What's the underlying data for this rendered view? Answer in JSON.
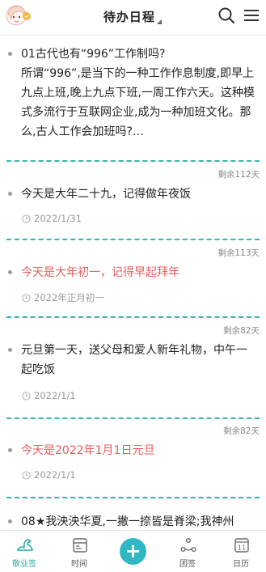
{
  "header": {
    "title": "待办日程",
    "caret": "◢"
  },
  "items": [
    {
      "text": "01古代也有“996”工作制吗?\n所谓“996”,是当下的一种工作作息制度,即早上九点上班,晚上九点下班,一周工作六天。这种模式多流行于互联网企业,成为一种加班文化。那么,古人工作会加班吗?…",
      "date": "",
      "highlight": false,
      "remaining": "剩余112天"
    },
    {
      "text": "今天是大年二十九，记得做年夜饭",
      "date": "2022/1/31",
      "highlight": false,
      "remaining": "剩余113天"
    },
    {
      "text": "今天是大年初一，记得早起拜年",
      "date": "2022年正月初一",
      "highlight": true,
      "remaining": "剩余82天"
    },
    {
      "text": "元旦第一天，送父母和爱人新年礼物，中午一起吃饭",
      "date": "2022/1/1",
      "highlight": false,
      "remaining": "剩余82天"
    },
    {
      "text": "今天是2022年1月1日元旦",
      "date": "2022/1/1",
      "highlight": true,
      "remaining": ""
    },
    {
      "text": "08★我泱泱华夏,一撇一捺皆是脊梁;我神州",
      "date": "",
      "highlight": false,
      "remaining": ""
    }
  ],
  "tabbar": {
    "tabs": [
      {
        "label": "敬业签",
        "icon": "swan-icon",
        "active": true
      },
      {
        "label": "时间",
        "icon": "calendar-grid-icon",
        "active": false
      },
      {
        "label": "团签",
        "icon": "team-dots-icon",
        "active": false
      },
      {
        "label": "日历",
        "icon": "calendar-day-icon",
        "active": false,
        "badge": "11"
      }
    ],
    "add_label": "+"
  },
  "colors": {
    "accent": "#33b5b0",
    "highlight_text": "#e65c5c",
    "fab": "#31b6c4"
  }
}
